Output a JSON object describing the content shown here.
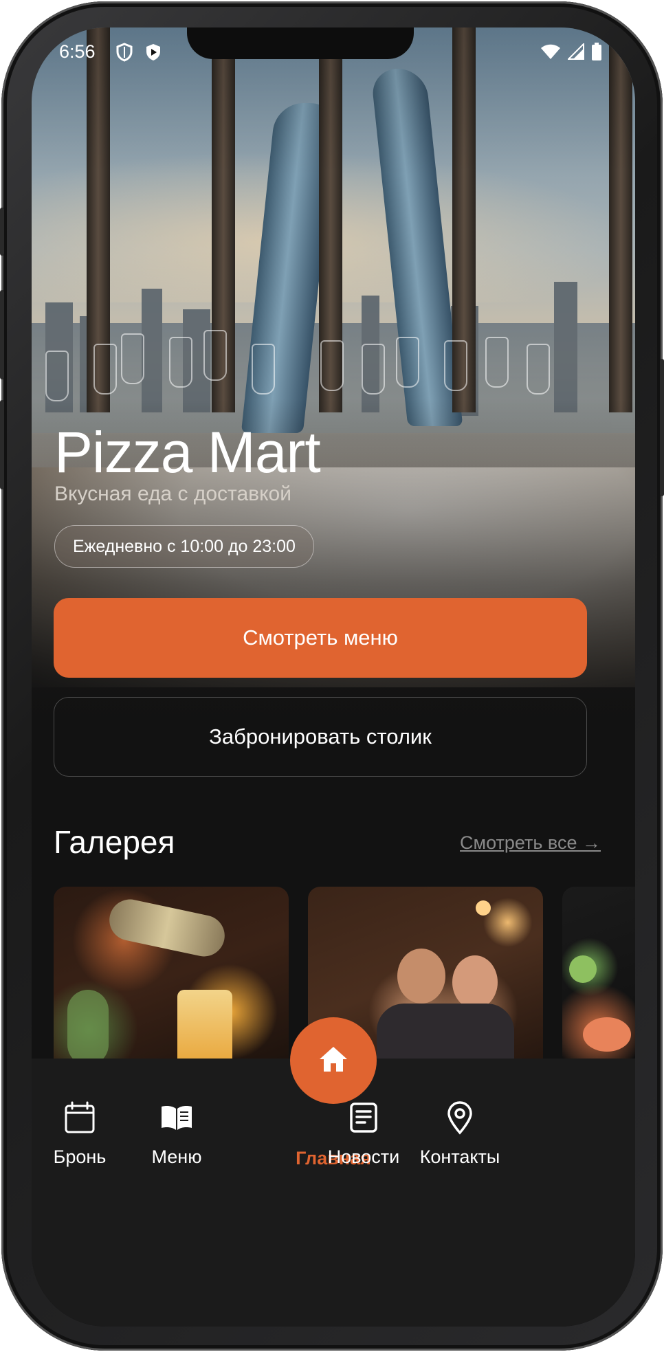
{
  "status_bar": {
    "time": "6:56",
    "left_icons": [
      "shield-outline-icon",
      "shield-play-icon"
    ],
    "right_icons": [
      "wifi-icon",
      "cellular-signal-icon",
      "battery-icon"
    ]
  },
  "hero": {
    "title": "Pizza Mart",
    "subtitle": "Вкусная еда с доставкой",
    "hours": "Ежедневно с 10:00 до 23:00"
  },
  "actions": {
    "primary_label": "Смотреть меню",
    "secondary_label": "Забронировать столик"
  },
  "gallery": {
    "title": "Галерея",
    "see_all_label": "Смотреть все →"
  },
  "tab_bar": {
    "items": [
      {
        "label": "Бронь",
        "icon": "calendar-icon"
      },
      {
        "label": "Меню",
        "icon": "book-icon"
      },
      {
        "label": "Главная",
        "icon": "home-icon",
        "active": true
      },
      {
        "label": "Новости",
        "icon": "news-icon"
      },
      {
        "label": "Контакты",
        "icon": "location-pin-icon"
      }
    ]
  },
  "colors": {
    "accent": "#e06430",
    "background": "#121212",
    "tab_bar": "#1b1b1b"
  }
}
